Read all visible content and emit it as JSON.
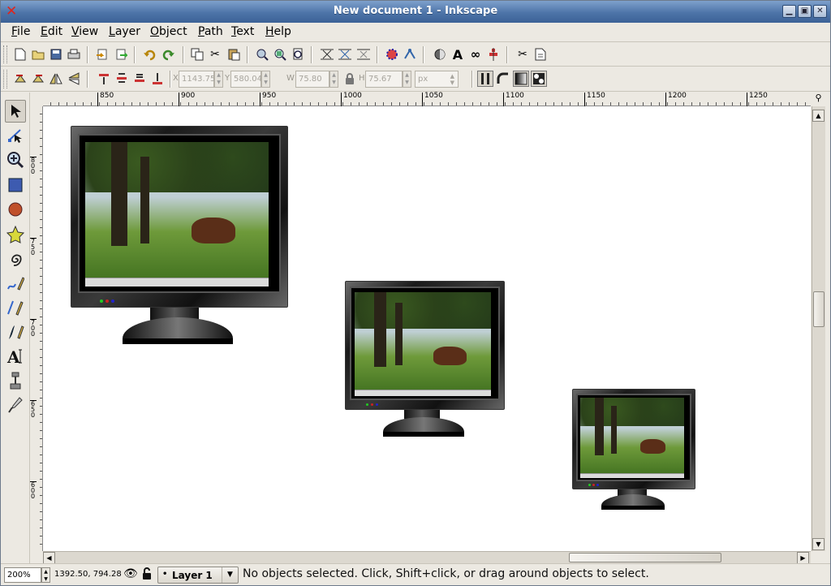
{
  "window": {
    "title": "New document 1 - Inkscape"
  },
  "menubar": {
    "items": [
      {
        "label": "File",
        "key": "F",
        "rest": "ile"
      },
      {
        "label": "Edit",
        "key": "E",
        "rest": "dit"
      },
      {
        "label": "View",
        "key": "V",
        "rest": "iew"
      },
      {
        "label": "Layer",
        "key": "L",
        "rest": "ayer"
      },
      {
        "label": "Object",
        "key": "O",
        "rest": "bject"
      },
      {
        "label": "Path",
        "key": "P",
        "rest": "ath"
      },
      {
        "label": "Text",
        "key": "T",
        "rest": "ext"
      },
      {
        "label": "Help",
        "key": "H",
        "rest": "elp"
      }
    ]
  },
  "commands": {
    "icons": [
      "new-document-icon",
      "open-icon",
      "save-icon",
      "print-icon",
      "import-icon",
      "export-icon",
      "undo-icon",
      "redo-icon",
      "duplicate-icon",
      "cut-icon",
      "paste-icon",
      "zoom-selection-icon",
      "zoom-drawing-icon",
      "zoom-page-icon",
      "group-icon",
      "ungroup-icon",
      "lower-icon",
      "fill-stroke-icon",
      "node-editor-icon",
      "text-icon",
      "xml-editor-icon",
      "align-icon",
      "preferences-icon",
      "document-properties-icon"
    ]
  },
  "controls": {
    "x_label": "X",
    "x_value": "1143.75",
    "y_label": "Y",
    "y_value": "580.04",
    "w_label": "W",
    "w_value": "75.80",
    "h_label": "H",
    "h_value": "75.67",
    "unit": "px"
  },
  "ruler": {
    "h_ticks": [
      "850",
      "900",
      "950",
      "1000",
      "1050",
      "1100",
      "1150",
      "1200",
      "1250"
    ],
    "v_ticks": [
      "800",
      "750",
      "700",
      "650",
      "600"
    ]
  },
  "toolbox": {
    "tools": [
      "selector-tool-icon",
      "node-tool-icon",
      "zoom-tool-icon",
      "rectangle-tool-icon",
      "ellipse-tool-icon",
      "star-tool-icon",
      "spiral-tool-icon",
      "pencil-tool-icon",
      "pen-tool-icon",
      "calligraphy-tool-icon",
      "text-tool-icon",
      "connector-tool-icon",
      "dropper-tool-icon"
    ]
  },
  "status": {
    "zoom": "200%",
    "cursor": "1392.50, 794.28",
    "layer": "Layer 1",
    "message": "No objects selected. Click, Shift+click, or drag around objects to select."
  }
}
